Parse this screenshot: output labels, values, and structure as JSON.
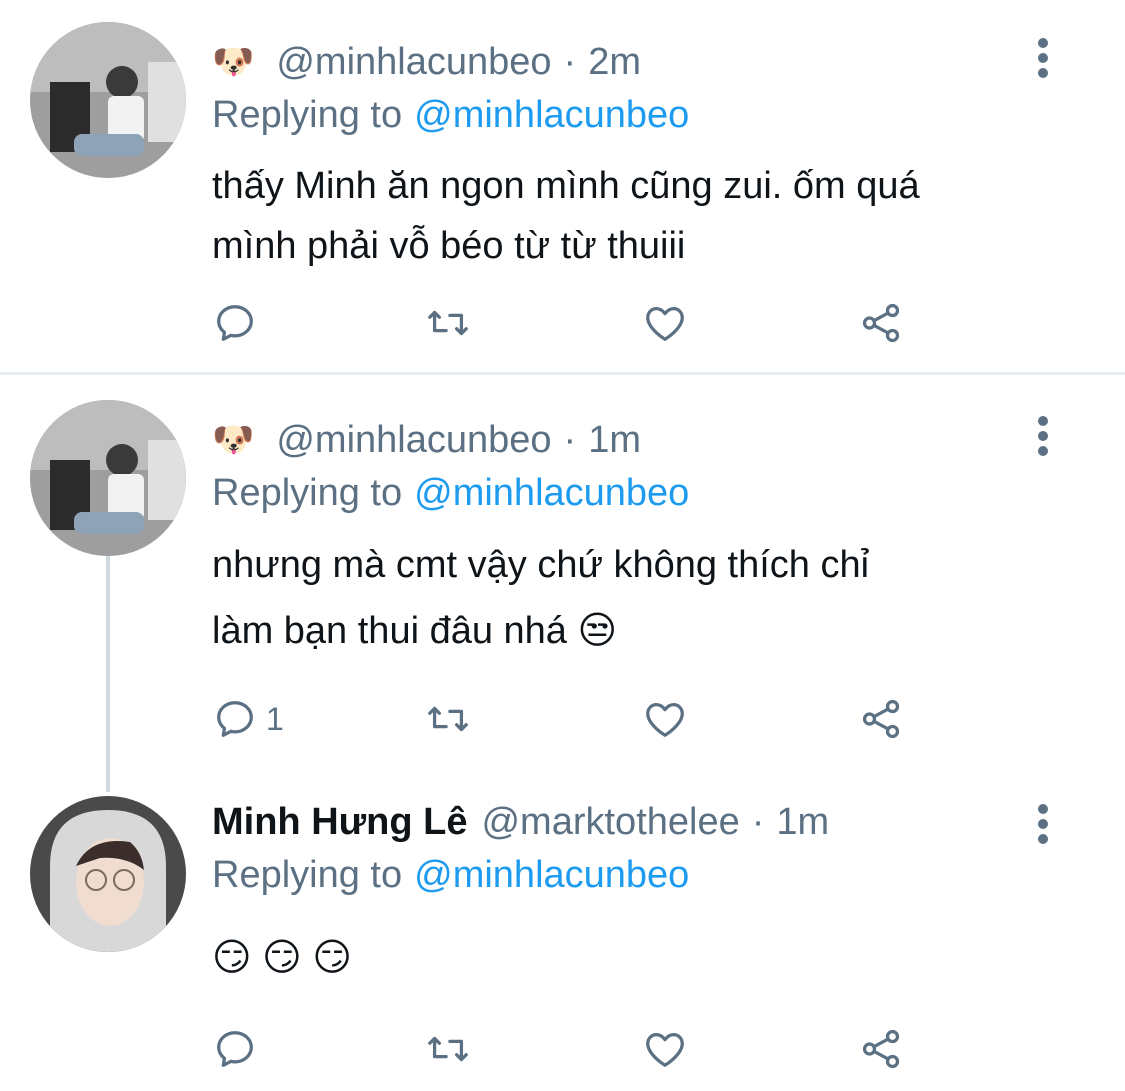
{
  "tweets": [
    {
      "emoji": "🐶",
      "display_name": "",
      "handle": "@minhlacunbeo",
      "time": "2m",
      "replying_label": "Replying to",
      "replying_to": "@minhlacunbeo",
      "text_lines": [
        "thấy Minh ăn ngon mình cũng zui. ốm quá",
        "mình phải vỗ béo từ từ thuiii"
      ],
      "reply_count": ""
    },
    {
      "emoji": "🐶",
      "display_name": "",
      "handle": "@minhlacunbeo",
      "time": "1m",
      "replying_label": "Replying to",
      "replying_to": "@minhlacunbeo",
      "text_lines": [
        "nhưng mà cmt vậy chứ không thích chỉ",
        "làm bạn thui đâu nhá 😒"
      ],
      "reply_count": "1"
    },
    {
      "emoji": "",
      "display_name": "Minh Hưng Lê",
      "handle": "@marktothelee",
      "time": "1m",
      "replying_label": "Replying to",
      "replying_to": "@minhlacunbeo",
      "text_lines": [
        "😏 😏 😏"
      ],
      "reply_count": ""
    }
  ],
  "separator": "·",
  "icons": {
    "reply": "reply-icon",
    "retweet": "retweet-icon",
    "like": "heart-icon",
    "share": "share-icon",
    "more": "more-icon"
  },
  "colors": {
    "text": "#0f1419",
    "secondary": "#5b7083",
    "link": "#1d9bf0",
    "divider": "#e6ecf0"
  }
}
